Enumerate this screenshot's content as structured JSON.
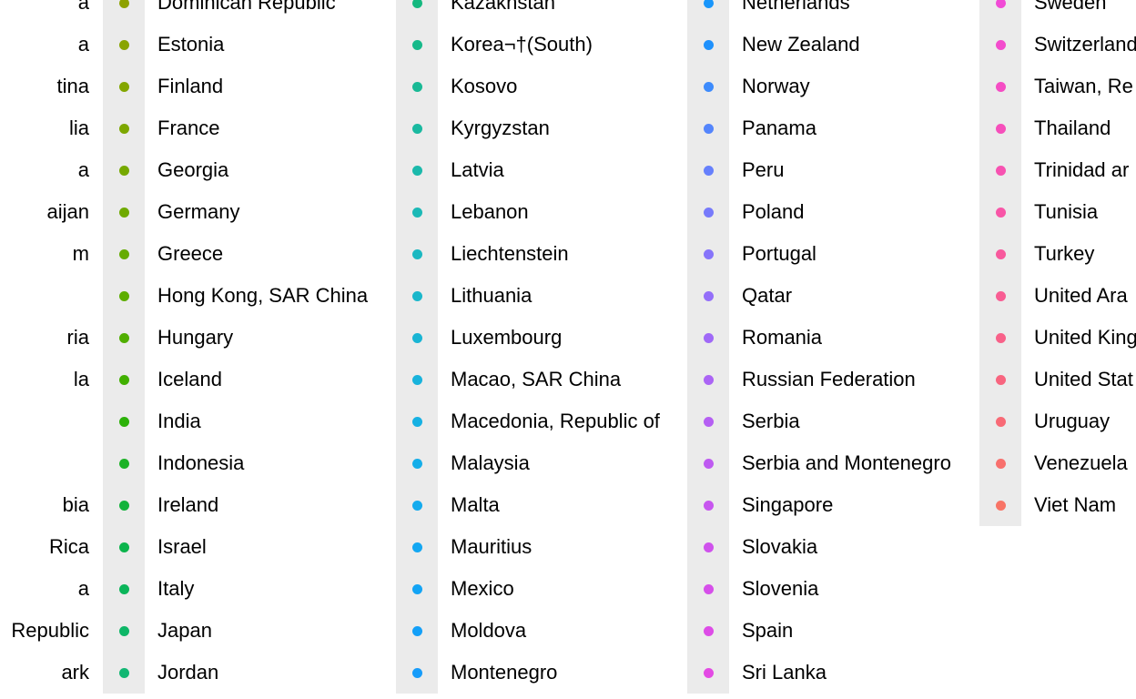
{
  "chart_data": {
    "type": "legend",
    "series": [
      {
        "name": "a",
        "color": "#f8766d"
      },
      {
        "name": "a",
        "color": "#f67971"
      },
      {
        "name": "tina",
        "color": "#f47c75"
      },
      {
        "name": "lia",
        "color": "#f27f78"
      },
      {
        "name": "a",
        "color": "#f0827c"
      },
      {
        "name": "aijan",
        "color": "#ee8580"
      },
      {
        "name": "m",
        "color": "#ec8884"
      },
      {
        "name": "",
        "color": "#ea8b88"
      },
      {
        "name": "ria",
        "color": "#e88e8c"
      },
      {
        "name": "la",
        "color": "#e69190"
      },
      {
        "name": "",
        "color": "#e49494"
      },
      {
        "name": "",
        "color": "#e29798"
      },
      {
        "name": "bia",
        "color": "#e09a9c"
      },
      {
        "name": "Rica",
        "color": "#de9da0"
      },
      {
        "name": "a",
        "color": "#dca0a4"
      },
      {
        "name": "Republic",
        "color": "#daa3a8"
      },
      {
        "name": "ark",
        "color": "#d8a6ac"
      },
      {
        "name": "Dominican Republic",
        "color": "#8ea200"
      },
      {
        "name": "Estonia",
        "color": "#89a400"
      },
      {
        "name": "Finland",
        "color": "#83a600"
      },
      {
        "name": "France",
        "color": "#7da700"
      },
      {
        "name": "Georgia",
        "color": "#76a900"
      },
      {
        "name": "Germany",
        "color": "#6faa00"
      },
      {
        "name": "Greece",
        "color": "#66ab00"
      },
      {
        "name": "Hong Kong, SAR China",
        "color": "#5cad00"
      },
      {
        "name": "Hungary",
        "color": "#50ae00"
      },
      {
        "name": "Iceland",
        "color": "#41b000"
      },
      {
        "name": "India",
        "color": "#2cb109"
      },
      {
        "name": "Indonesia",
        "color": "#1db227"
      },
      {
        "name": "Ireland",
        "color": "#12b33b"
      },
      {
        "name": "Israel",
        "color": "#0cb44c"
      },
      {
        "name": "Italy",
        "color": "#0bb55a"
      },
      {
        "name": "Japan",
        "color": "#0eb667"
      },
      {
        "name": "Jordan",
        "color": "#12b773"
      },
      {
        "name": "Kazakhstan",
        "color": "#15b87f"
      },
      {
        "name": "Korea¬†(South)",
        "color": "#17b98a"
      },
      {
        "name": "Kosovo",
        "color": "#19b995"
      },
      {
        "name": "Kyrgyzstan",
        "color": "#1ab9a0"
      },
      {
        "name": "Latvia",
        "color": "#1bb9ab"
      },
      {
        "name": "Lebanon",
        "color": "#1bb9b6"
      },
      {
        "name": "Liechtenstein",
        "color": "#1bb8c1"
      },
      {
        "name": "Lithuania",
        "color": "#1ab7cb"
      },
      {
        "name": "Luxembourg",
        "color": "#19b5d4"
      },
      {
        "name": "Macao, SAR China",
        "color": "#18b3dc"
      },
      {
        "name": "Macedonia, Republic of",
        "color": "#16b1e3"
      },
      {
        "name": "Malaysia",
        "color": "#15aee9"
      },
      {
        "name": "Malta",
        "color": "#14abee"
      },
      {
        "name": "Mauritius",
        "color": "#13a7f2"
      },
      {
        "name": "Mexico",
        "color": "#13a4f5"
      },
      {
        "name": "Moldova",
        "color": "#14a0f8"
      },
      {
        "name": "Montenegro",
        "color": "#169cfa"
      },
      {
        "name": "Netherlands",
        "color": "#1996fb"
      },
      {
        "name": "New Zealand",
        "color": "#1f91fc"
      },
      {
        "name": "Norway",
        "color": "#3d8bfc"
      },
      {
        "name": "Panama",
        "color": "#5485fc"
      },
      {
        "name": "Peru",
        "color": "#6680fc"
      },
      {
        "name": "Poland",
        "color": "#777afb"
      },
      {
        "name": "Portugal",
        "color": "#8674fa"
      },
      {
        "name": "Qatar",
        "color": "#946ff9"
      },
      {
        "name": "Romania",
        "color": "#a069f7"
      },
      {
        "name": "Russian Federation",
        "color": "#ab64f5"
      },
      {
        "name": "Serbia",
        "color": "#b55ff3"
      },
      {
        "name": "Serbia and Montenegro",
        "color": "#be5af1"
      },
      {
        "name": "Singapore",
        "color": "#c756ef"
      },
      {
        "name": "Slovakia",
        "color": "#cf52ec"
      },
      {
        "name": "Slovenia",
        "color": "#d64fea"
      },
      {
        "name": "Spain",
        "color": "#dd4ce7"
      },
      {
        "name": "Sri Lanka",
        "color": "#e34ae4"
      },
      {
        "name": "Sweden",
        "color": "#f14bd6"
      },
      {
        "name": "Switzerland",
        "color": "#f34ccd"
      },
      {
        "name": "Taiwan, Re",
        "color": "#f54dc4"
      },
      {
        "name": "Thailand",
        "color": "#f64fbb"
      },
      {
        "name": "Trinidad ar",
        "color": "#f752b1"
      },
      {
        "name": "Tunisia",
        "color": "#f855a7"
      },
      {
        "name": "Turkey",
        "color": "#f8599d"
      },
      {
        "name": "United Ara",
        "color": "#f85d93"
      },
      {
        "name": "United King",
        "color": "#f86189"
      },
      {
        "name": "United Stat",
        "color": "#f8657f"
      },
      {
        "name": "Uruguay",
        "color": "#f86a76"
      },
      {
        "name": "Venezuela",
        "color": "#f8706d"
      },
      {
        "name": "Viet Nam",
        "color": "#f87466"
      }
    ]
  }
}
